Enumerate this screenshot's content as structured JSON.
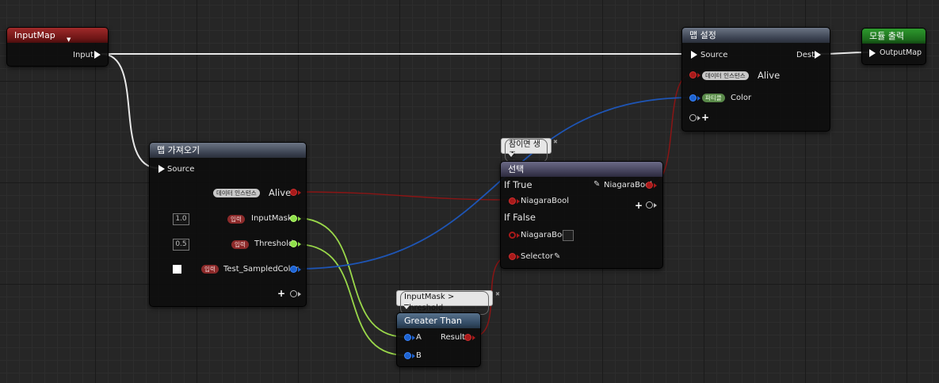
{
  "colors": {
    "exec": "#ffffff",
    "bool": "#a81a1a",
    "float": "#8ee04a",
    "color": "#1e63d0"
  },
  "input_map": {
    "title": "InputMap",
    "pin_label": "Input"
  },
  "get_map": {
    "title": "맵 가져오기",
    "source": "Source",
    "alive_badge": "데이터 인스턴스",
    "alive": "Alive",
    "input_badge": "입력",
    "input_mask": "InputMask",
    "input_mask_value": "1.0",
    "threshold": "Threshold",
    "threshold_value": "0.5",
    "sampled_color": "Test_SampledColor"
  },
  "set_map": {
    "title": "맵 설정",
    "source": "Source",
    "dest": "Dest",
    "alive_badge": "데이터 인스턴스",
    "alive": "Alive",
    "color_badge": "파티클",
    "color": "Color"
  },
  "output": {
    "title": "모듈 출력",
    "pin_label": "OutputMap"
  },
  "select": {
    "comment": "참이면 생존",
    "title": "선택",
    "if_true": "If True",
    "niagara_bool_out": "NiagaraBool",
    "niagara_bool_true": "NiagaraBool",
    "if_false": "If False",
    "niagara_bool_false": "NiagaraBool",
    "selector": "Selector"
  },
  "greater": {
    "comment": "InputMask > Threshold",
    "title": "Greater Than",
    "a": "A",
    "b": "B",
    "result": "Result"
  },
  "icons": {
    "add": "plus-icon",
    "edit": "pencil-icon",
    "close": "close-icon",
    "dropdown": "chevron-down-icon"
  }
}
